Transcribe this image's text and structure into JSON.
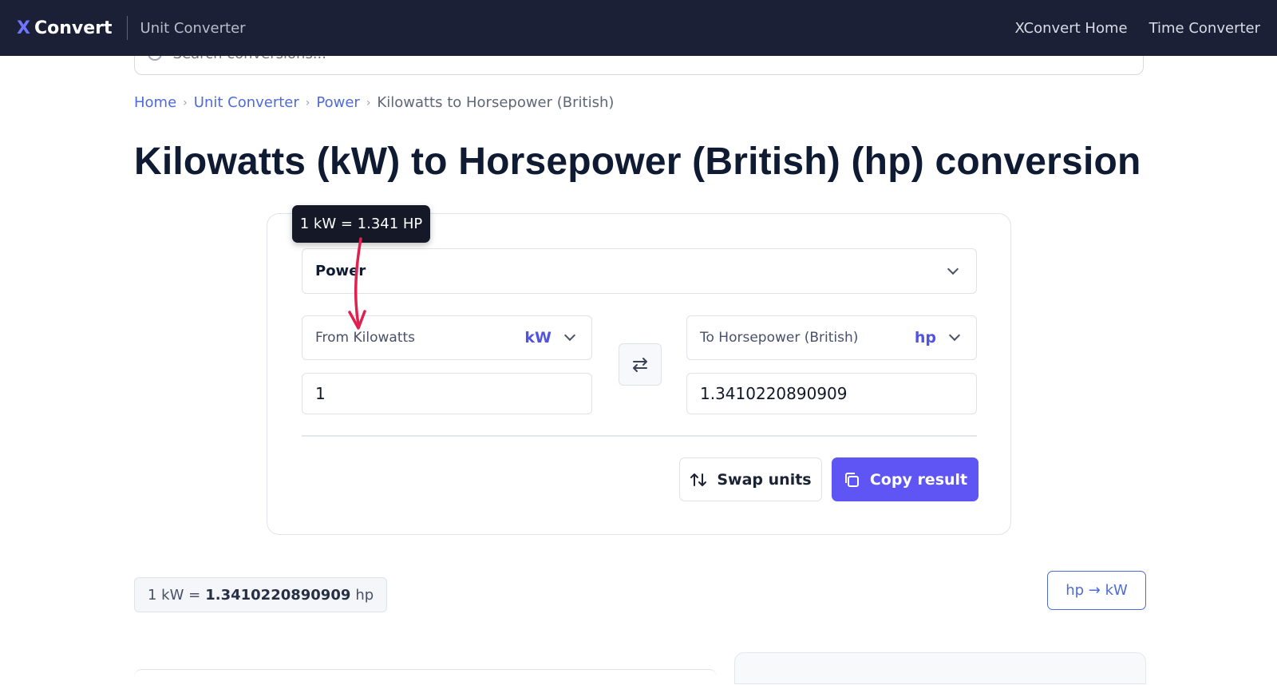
{
  "header": {
    "logo_x": "X",
    "logo_text": "Convert",
    "subtitle": "Unit Converter",
    "nav": [
      "XConvert Home",
      "Time Converter"
    ]
  },
  "search": {
    "placeholder": "Search conversions..."
  },
  "breadcrumb": {
    "items": [
      "Home",
      "Unit Converter",
      "Power"
    ],
    "current": "Kilowatts to Horsepower (British)"
  },
  "title": "Kilowatts (kW) to Horsepower (British) (hp) conversion",
  "tooltip": "1 kW = 1.341 HP",
  "converter": {
    "category": "Power",
    "from_label": "From Kilowatts",
    "from_abbr": "kW",
    "from_value": "1",
    "to_label": "To Horsepower (British)",
    "to_abbr": "hp",
    "to_value": "1.3410220890909",
    "swap_label": "Swap units",
    "copy_label": "Copy result"
  },
  "result": {
    "prefix": "1 kW =",
    "value": "1.3410220890909",
    "unit": "hp"
  },
  "reverse_link": "hp → kW",
  "colors": {
    "header_bg": "#1b2036",
    "accent": "#5f55f5",
    "link": "#4f6bd8",
    "annotation_arrow": "#e0214f"
  }
}
